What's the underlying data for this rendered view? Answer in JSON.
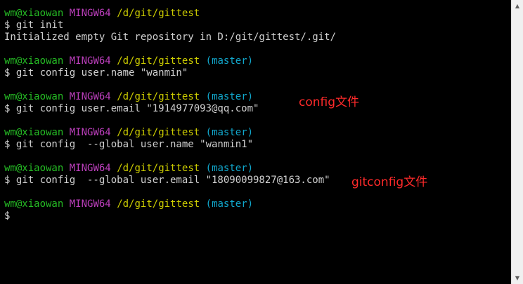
{
  "terminal": {
    "blocks": [
      {
        "prompt": {
          "user": "wm@xiaowan",
          "system": "MINGW64",
          "path": "/d/git/gittest",
          "branch": ""
        },
        "command": "$ git init",
        "output": "Initialized empty Git repository in D:/git/gittest/.git/"
      },
      {
        "prompt": {
          "user": "wm@xiaowan",
          "system": "MINGW64",
          "path": "/d/git/gittest",
          "branch": "(master)"
        },
        "command": "$ git config user.name \"wanmin\""
      },
      {
        "prompt": {
          "user": "wm@xiaowan",
          "system": "MINGW64",
          "path": "/d/git/gittest",
          "branch": "(master)"
        },
        "command": "$ git config user.email \"1914977093@qq.com\""
      },
      {
        "prompt": {
          "user": "wm@xiaowan",
          "system": "MINGW64",
          "path": "/d/git/gittest",
          "branch": "(master)"
        },
        "command": "$ git config  --global user.name \"wanmin1\""
      },
      {
        "prompt": {
          "user": "wm@xiaowan",
          "system": "MINGW64",
          "path": "/d/git/gittest",
          "branch": "(master)"
        },
        "command": "$ git config  --global user.email \"18090099827@163.com\""
      },
      {
        "prompt": {
          "user": "wm@xiaowan",
          "system": "MINGW64",
          "path": "/d/git/gittest",
          "branch": "(master)"
        },
        "command": "$"
      }
    ]
  },
  "annotations": {
    "config_note": "config文件",
    "gitconfig_note": "gitconfig文件"
  },
  "scrollbar": {
    "up_icon": "scroll-up-arrow",
    "down_icon": "scroll-down-arrow",
    "up_glyph": "▲",
    "down_glyph": "▼"
  },
  "colors": {
    "background": "#000000",
    "user_host": "#25bc24",
    "system": "#bc3fbc",
    "path": "#cdcd00",
    "branch": "#11a8cd",
    "text": "#d0d0d0",
    "annotation": "#ff2a2a"
  }
}
